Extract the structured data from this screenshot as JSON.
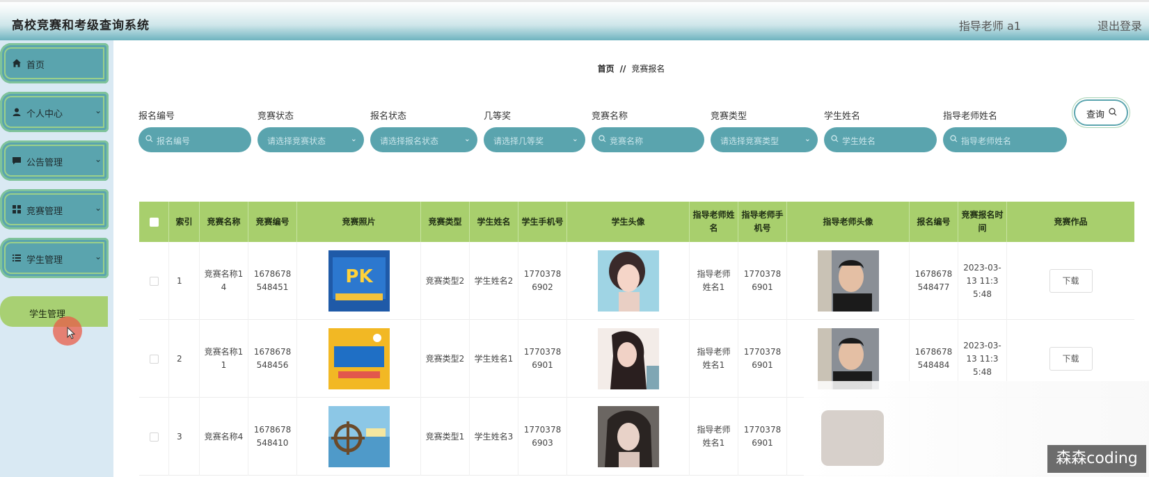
{
  "header": {
    "title": "高校竞赛和考级查询系统",
    "user": "指导老师 a1",
    "logout": "退出登录"
  },
  "sidebar": {
    "items": [
      {
        "label": "首页",
        "icon": "home-icon"
      },
      {
        "label": "个人中心",
        "icon": "user-icon"
      },
      {
        "label": "公告管理",
        "icon": "chat-icon"
      },
      {
        "label": "竞赛管理",
        "icon": "grid-icon"
      },
      {
        "label": "学生管理",
        "icon": "list-icon"
      }
    ],
    "submenu_label": "学生管理"
  },
  "breadcrumb": {
    "home": "首页",
    "separator": "//",
    "current": "竞赛报名"
  },
  "filters": [
    {
      "label": "报名编号",
      "placeholder": "报名编号",
      "type": "text"
    },
    {
      "label": "竞赛状态",
      "placeholder": "请选择竞赛状态",
      "type": "select"
    },
    {
      "label": "报名状态",
      "placeholder": "请选择报名状态",
      "type": "select"
    },
    {
      "label": "几等奖",
      "placeholder": "请选择几等奖",
      "type": "select"
    },
    {
      "label": "竞赛名称",
      "placeholder": "竞赛名称",
      "type": "text"
    },
    {
      "label": "竞赛类型",
      "placeholder": "请选择竞赛类型",
      "type": "select"
    },
    {
      "label": "学生姓名",
      "placeholder": "学生姓名",
      "type": "text"
    },
    {
      "label": "指导老师姓名",
      "placeholder": "指导老师姓名",
      "type": "text"
    }
  ],
  "query_button": "查询",
  "table": {
    "headers": [
      "索引",
      "竞赛名称",
      "竞赛编号",
      "竞赛照片",
      "竞赛类型",
      "学生姓名",
      "学生手机号",
      "学生头像",
      "指导老师姓名",
      "指导老师手机号",
      "指导老师头像",
      "报名编号",
      "竞赛报名时间",
      "竞赛作品"
    ],
    "rows": [
      {
        "index": "1",
        "name": "竞赛名称14",
        "code": "1678678548451",
        "type": "竞赛类型2",
        "student": "学生姓名2",
        "phone": "17703786902",
        "teacher": "指导老师姓名1",
        "teacher_phone": "17703786901",
        "reg_code": "1678678548477",
        "time": "2023-03-13 11:35:48",
        "work": "下载"
      },
      {
        "index": "2",
        "name": "竞赛名称11",
        "code": "1678678548456",
        "type": "竞赛类型2",
        "student": "学生姓名1",
        "phone": "17703786901",
        "teacher": "指导老师姓名1",
        "teacher_phone": "17703786901",
        "reg_code": "1678678548484",
        "time": "2023-03-13 11:35:48",
        "work": "下载"
      },
      {
        "index": "3",
        "name": "竞赛名称4",
        "code": "1678678548410",
        "type": "竞赛类型1",
        "student": "学生姓名3",
        "phone": "17703786903",
        "teacher": "指导老师姓名1",
        "teacher_phone": "17703786901",
        "reg_code": "",
        "time": "",
        "work": ""
      }
    ]
  },
  "watermark": "森森coding"
}
